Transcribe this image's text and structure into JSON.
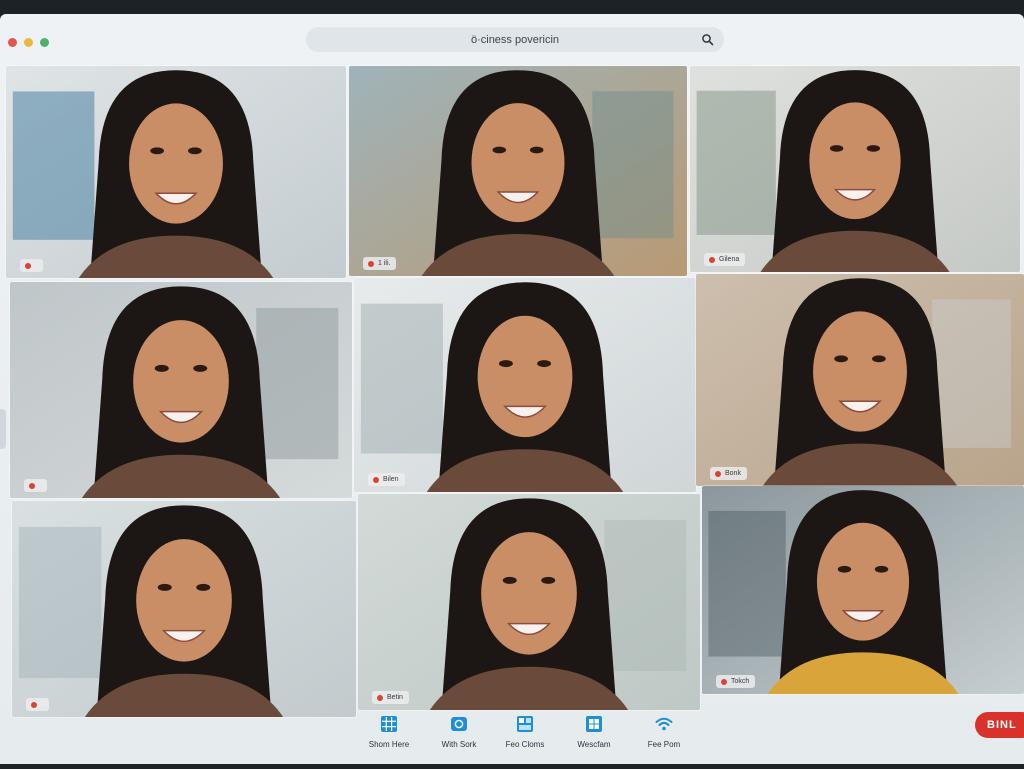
{
  "window": {
    "search_text": "ö·ciness povericin"
  },
  "participants": [
    {
      "label": "Video call participant",
      "tag": " "
    },
    {
      "label": "Video call participant",
      "tag": "1 ili."
    },
    {
      "label": "Video call participant",
      "tag": "Gilena"
    },
    {
      "label": "Video call participant",
      "tag": " "
    },
    {
      "label": "Video call participant",
      "tag": "Bilen"
    },
    {
      "label": "Video call participant",
      "tag": "Bonk"
    },
    {
      "label": "Video call participant",
      "tag": " "
    },
    {
      "label": "Video call participant",
      "tag": "Betin"
    },
    {
      "label": "Video call participant",
      "tag": "Tokch"
    }
  ],
  "toolbar": {
    "items": [
      {
        "label": "Shom Here",
        "icon": "grid-icon"
      },
      {
        "label": "With Sork",
        "icon": "camera-icon"
      },
      {
        "label": "Feo Cloms",
        "icon": "layout-icon"
      },
      {
        "label": "Wescfam",
        "icon": "windows-icon"
      },
      {
        "label": "Fee Pom",
        "icon": "wifi-icon"
      }
    ],
    "end_label": "BINL"
  },
  "colors": {
    "accent": "#1e8fd6",
    "end_button": "#d8322a",
    "mic_status": "#d9432f"
  }
}
